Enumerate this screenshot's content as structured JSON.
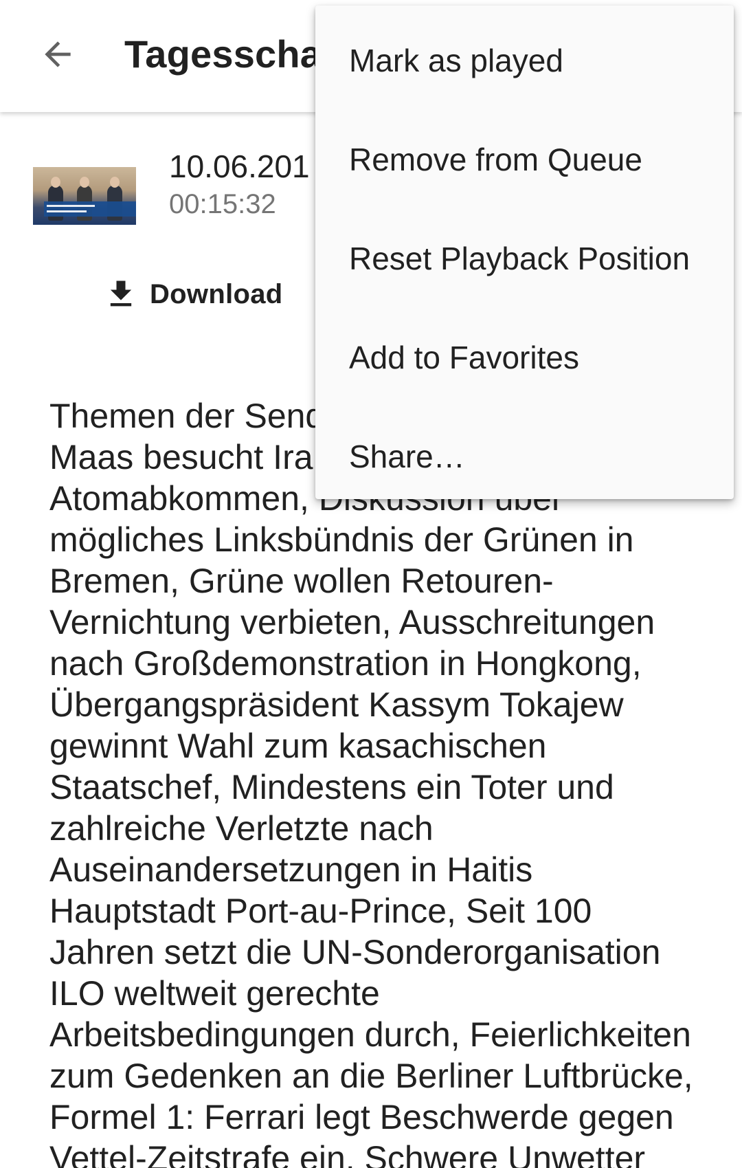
{
  "toolbar": {
    "back_icon": "arrow-back-icon",
    "title": "Tagesscha"
  },
  "episode": {
    "thumbnail_icon": "episode-thumbnail",
    "date": "10.06.201",
    "duration": "00:15:32",
    "download_icon": "download-icon",
    "download_label": "Download"
  },
  "description": {
    "text": "Themen der Send\nMaas besucht Ira\nAtomabkommen, Diskussion über\nmögliches Linksbündnis der Grünen in\nBremen, Grüne wollen Retouren-\nVernichtung verbieten, Ausschreitungen\nnach Großdemonstration in Hongkong,\nÜbergangspräsident Kassym Tokajew\ngewinnt Wahl zum kasachischen\nStaatschef, Mindestens ein Toter und\nzahlreiche Verletzte nach\nAuseinandersetzungen in Haitis\nHauptstadt Port-au-Prince, Seit 100\nJahren setzt die UN-Sonderorganisation\nILO weltweit gerechte\nArbeitsbedingungen durch, Feierlichkeiten\nzum Gedenken an die Berliner Luftbrücke,\nFormel 1: Ferrari legt Beschwerde gegen\nVettel-Zeitstrafe ein, Schwere Unwetter"
  },
  "menu": {
    "items": [
      {
        "label": "Mark as played"
      },
      {
        "label": "Remove from Queue"
      },
      {
        "label": "Reset Playback Position"
      },
      {
        "label": "Add to Favorites"
      },
      {
        "label": "Share…"
      }
    ]
  },
  "colors": {
    "text_primary": "#212121",
    "text_secondary": "#757575",
    "menu_background": "#fafafa",
    "divider": "#9e9e9e"
  }
}
